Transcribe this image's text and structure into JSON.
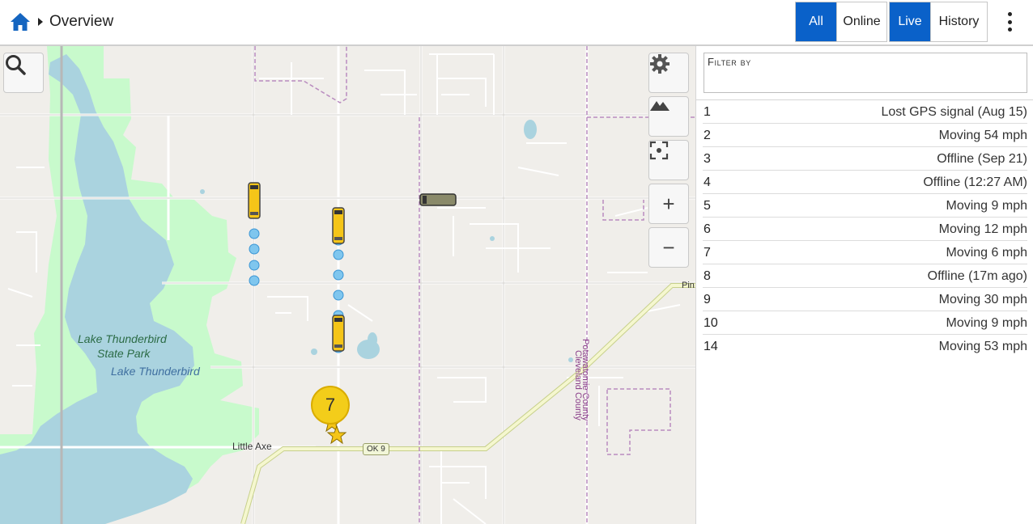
{
  "header": {
    "title": "Overview",
    "filter_all": "All",
    "filter_online": "Online",
    "mode_live": "Live",
    "mode_history": "History"
  },
  "map": {
    "labels": {
      "park": "Lake Thunderbird\nState Park",
      "park_line1": "Lake Thunderbird",
      "park_line2": "State Park",
      "lake": "Lake Thunderbird",
      "town": "Little Axe",
      "route": "OK 9",
      "county_east": "Potawatomie County",
      "county_west": "Cleveland County",
      "edge_place": "Pin"
    },
    "cluster_count": "7",
    "colors": {
      "water": "#aad3df",
      "park": "#c8facc",
      "land": "#f0eeea",
      "vehicle": "#f5c518",
      "trail": "#7fc6ee"
    }
  },
  "sidebar": {
    "filter_label": "Filter by",
    "filter_value": "",
    "items": [
      {
        "id": "1",
        "status": "Lost GPS signal (Aug 15)"
      },
      {
        "id": "2",
        "status": "Moving 54 mph"
      },
      {
        "id": "3",
        "status": "Offline (Sep 21)"
      },
      {
        "id": "4",
        "status": "Offline (12:27 AM)"
      },
      {
        "id": "5",
        "status": "Moving 9 mph"
      },
      {
        "id": "6",
        "status": "Moving 12 mph"
      },
      {
        "id": "7",
        "status": "Moving 6 mph"
      },
      {
        "id": "8",
        "status": "Offline (17m ago)"
      },
      {
        "id": "9",
        "status": "Moving 30 mph"
      },
      {
        "id": "10",
        "status": "Moving 9 mph"
      },
      {
        "id": "14",
        "status": "Moving 53 mph"
      }
    ]
  },
  "icons": {
    "home": "home-icon",
    "search": "search-icon",
    "settings": "gear-icon",
    "terrain": "mountain-icon",
    "focus": "focus-icon",
    "zoom_in": "plus-icon",
    "zoom_out": "minus-icon",
    "menu": "kebab-menu-icon"
  },
  "zoom_in_glyph": "+",
  "zoom_out_glyph": "−"
}
